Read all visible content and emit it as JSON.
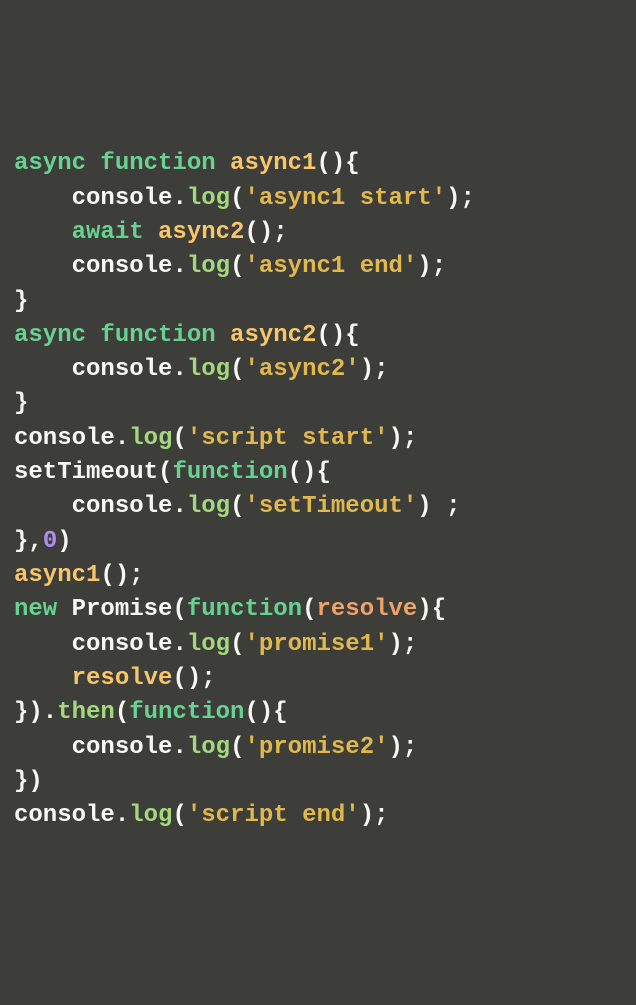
{
  "code": {
    "lines": [
      {
        "indent": 0,
        "tokens": [
          {
            "t": "async",
            "c": "kw"
          },
          {
            "t": " ",
            "c": "punc"
          },
          {
            "t": "function",
            "c": "kw"
          },
          {
            "t": " ",
            "c": "punc"
          },
          {
            "t": "async1",
            "c": "fn"
          },
          {
            "t": "(){",
            "c": "punc"
          }
        ]
      },
      {
        "indent": 1,
        "tokens": [
          {
            "t": "console",
            "c": "obj"
          },
          {
            "t": ".",
            "c": "punc"
          },
          {
            "t": "log",
            "c": "method"
          },
          {
            "t": "(",
            "c": "punc"
          },
          {
            "t": "'async1 start'",
            "c": "str"
          },
          {
            "t": ");",
            "c": "punc"
          }
        ]
      },
      {
        "indent": 1,
        "tokens": [
          {
            "t": "await",
            "c": "kw"
          },
          {
            "t": " ",
            "c": "punc"
          },
          {
            "t": "async2",
            "c": "fn"
          },
          {
            "t": "();",
            "c": "punc"
          }
        ]
      },
      {
        "indent": 1,
        "tokens": [
          {
            "t": "console",
            "c": "obj"
          },
          {
            "t": ".",
            "c": "punc"
          },
          {
            "t": "log",
            "c": "method"
          },
          {
            "t": "(",
            "c": "punc"
          },
          {
            "t": "'async1 end'",
            "c": "str"
          },
          {
            "t": ");",
            "c": "punc"
          }
        ]
      },
      {
        "indent": 0,
        "tokens": [
          {
            "t": "}",
            "c": "punc"
          }
        ]
      },
      {
        "indent": 0,
        "tokens": [
          {
            "t": "async",
            "c": "kw"
          },
          {
            "t": " ",
            "c": "punc"
          },
          {
            "t": "function",
            "c": "kw"
          },
          {
            "t": " ",
            "c": "punc"
          },
          {
            "t": "async2",
            "c": "fn"
          },
          {
            "t": "(){",
            "c": "punc"
          }
        ]
      },
      {
        "indent": 1,
        "tokens": [
          {
            "t": "console",
            "c": "obj"
          },
          {
            "t": ".",
            "c": "punc"
          },
          {
            "t": "log",
            "c": "method"
          },
          {
            "t": "(",
            "c": "punc"
          },
          {
            "t": "'async2'",
            "c": "str"
          },
          {
            "t": ");",
            "c": "punc"
          }
        ]
      },
      {
        "indent": 0,
        "tokens": [
          {
            "t": "}",
            "c": "punc"
          }
        ]
      },
      {
        "indent": 0,
        "tokens": [
          {
            "t": "console",
            "c": "obj"
          },
          {
            "t": ".",
            "c": "punc"
          },
          {
            "t": "log",
            "c": "method"
          },
          {
            "t": "(",
            "c": "punc"
          },
          {
            "t": "'script start'",
            "c": "str"
          },
          {
            "t": ");",
            "c": "punc"
          }
        ]
      },
      {
        "indent": 0,
        "tokens": [
          {
            "t": "setTimeout",
            "c": "obj"
          },
          {
            "t": "(",
            "c": "punc"
          },
          {
            "t": "function",
            "c": "kw"
          },
          {
            "t": "(){",
            "c": "punc"
          }
        ]
      },
      {
        "indent": 1,
        "tokens": [
          {
            "t": "console",
            "c": "obj"
          },
          {
            "t": ".",
            "c": "punc"
          },
          {
            "t": "log",
            "c": "method"
          },
          {
            "t": "(",
            "c": "punc"
          },
          {
            "t": "'setTimeout'",
            "c": "str"
          },
          {
            "t": ") ;",
            "c": "punc"
          }
        ]
      },
      {
        "indent": 0,
        "tokens": [
          {
            "t": "},",
            "c": "punc"
          },
          {
            "t": "0",
            "c": "num"
          },
          {
            "t": ")",
            "c": "punc"
          }
        ]
      },
      {
        "indent": 0,
        "tokens": [
          {
            "t": "async1",
            "c": "fn"
          },
          {
            "t": "();",
            "c": "punc"
          }
        ]
      },
      {
        "indent": 0,
        "tokens": [
          {
            "t": "new",
            "c": "kw"
          },
          {
            "t": " ",
            "c": "punc"
          },
          {
            "t": "Promise",
            "c": "obj"
          },
          {
            "t": "(",
            "c": "punc"
          },
          {
            "t": "function",
            "c": "kw"
          },
          {
            "t": "(",
            "c": "punc"
          },
          {
            "t": "resolve",
            "c": "param"
          },
          {
            "t": "){",
            "c": "punc"
          }
        ]
      },
      {
        "indent": 1,
        "tokens": [
          {
            "t": "console",
            "c": "obj"
          },
          {
            "t": ".",
            "c": "punc"
          },
          {
            "t": "log",
            "c": "method"
          },
          {
            "t": "(",
            "c": "punc"
          },
          {
            "t": "'promise1'",
            "c": "str"
          },
          {
            "t": ");",
            "c": "punc"
          }
        ]
      },
      {
        "indent": 1,
        "tokens": [
          {
            "t": "resolve",
            "c": "fn"
          },
          {
            "t": "();",
            "c": "punc"
          }
        ]
      },
      {
        "indent": 0,
        "tokens": [
          {
            "t": "}).",
            "c": "punc"
          },
          {
            "t": "then",
            "c": "method"
          },
          {
            "t": "(",
            "c": "punc"
          },
          {
            "t": "function",
            "c": "kw"
          },
          {
            "t": "(){",
            "c": "punc"
          }
        ]
      },
      {
        "indent": 1,
        "tokens": [
          {
            "t": "console",
            "c": "obj"
          },
          {
            "t": ".",
            "c": "punc"
          },
          {
            "t": "log",
            "c": "method"
          },
          {
            "t": "(",
            "c": "punc"
          },
          {
            "t": "'promise2'",
            "c": "str"
          },
          {
            "t": ");",
            "c": "punc"
          }
        ]
      },
      {
        "indent": 0,
        "tokens": [
          {
            "t": "})",
            "c": "punc"
          }
        ]
      },
      {
        "indent": 0,
        "tokens": [
          {
            "t": "console",
            "c": "obj"
          },
          {
            "t": ".",
            "c": "punc"
          },
          {
            "t": "log",
            "c": "method"
          },
          {
            "t": "(",
            "c": "punc"
          },
          {
            "t": "'script end'",
            "c": "str"
          },
          {
            "t": ");",
            "c": "punc"
          }
        ]
      }
    ]
  }
}
